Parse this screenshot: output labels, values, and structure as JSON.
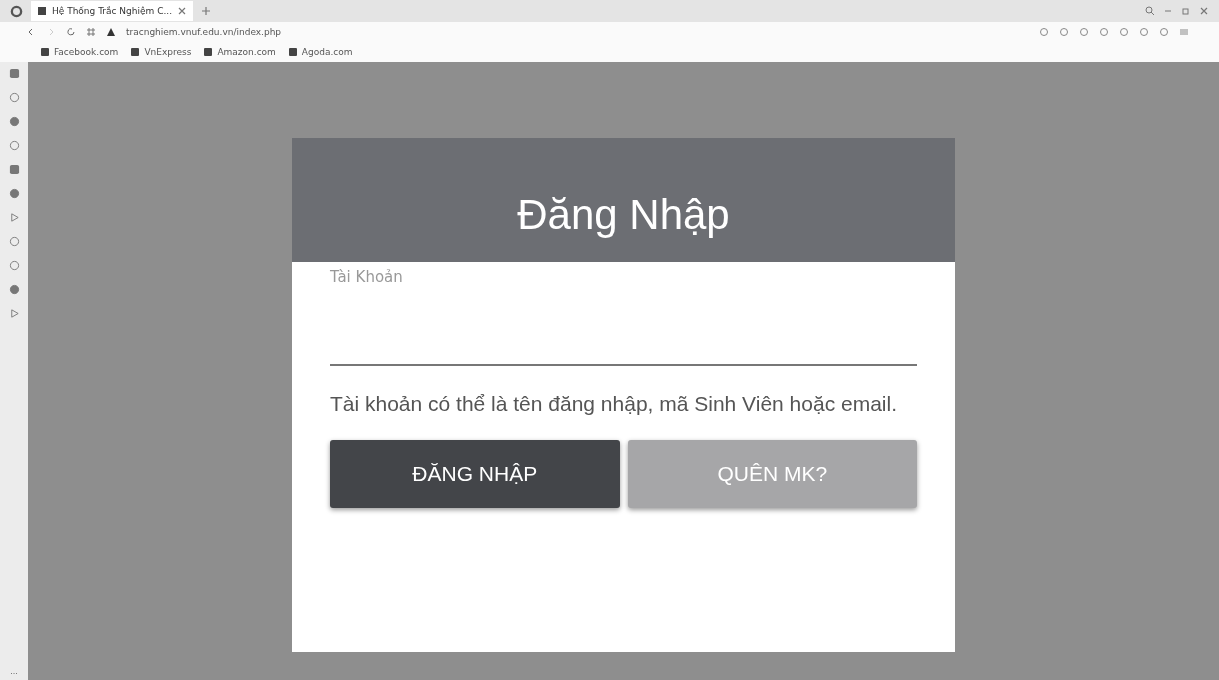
{
  "browser": {
    "tab_title": "Hệ Thống Trắc Nghiệm C...",
    "url": "tracnghiem.vnuf.edu.vn/index.php",
    "bookmarks": [
      "Facebook.com",
      "VnExpress",
      "Amazon.com",
      "Agoda.com"
    ]
  },
  "login": {
    "title": "Đăng Nhập",
    "field_label": "Tài Khoản",
    "help": "Tài khoản có thể là tên đăng nhập, mã Sinh Viên hoặc email.",
    "buttons": [
      {
        "label": "ĐĂNG NHẬP",
        "kind": "primary"
      },
      {
        "label": "QUÊN MK?",
        "kind": "secondary"
      }
    ]
  },
  "sidebar": {
    "more": "..."
  }
}
